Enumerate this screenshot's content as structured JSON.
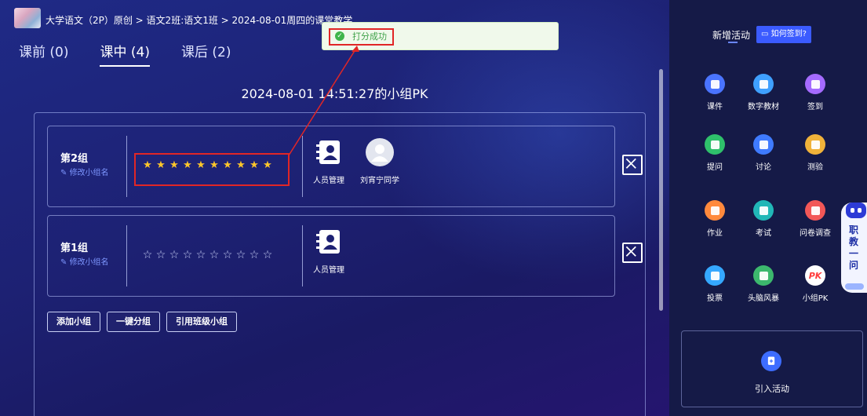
{
  "breadcrumb": {
    "course": "大学语文（2P）原创",
    "class": "语文2班:语文1班",
    "session": "2024-08-01周四的课堂教学",
    "sep": ">"
  },
  "tabs": [
    {
      "label": "课前 (0)",
      "active": false
    },
    {
      "label": "课中 (4)",
      "active": true
    },
    {
      "label": "课后 (2)",
      "active": false
    }
  ],
  "toast": {
    "message": "打分成功"
  },
  "pk_title": "2024-08-01 14:51:27的小组PK",
  "groups": [
    {
      "name": "第2组",
      "rename_label": "修改小组名",
      "stars": "★★★★★★★★★★",
      "rating": 10,
      "max_rating": 10,
      "members": [
        {
          "label": "人员管理",
          "icon": "contacts-icon"
        },
        {
          "label": "刘宵宁同学",
          "icon": "avatar-icon"
        }
      ]
    },
    {
      "name": "第1组",
      "rename_label": "修改小组名",
      "stars": "☆☆☆☆☆☆☆☆☆☆",
      "rating": 0,
      "max_rating": 10,
      "members": [
        {
          "label": "人员管理",
          "icon": "contacts-icon"
        }
      ]
    }
  ],
  "buttons": {
    "add_group": "添加小组",
    "auto_group": "一键分组",
    "import_class_group": "引用班级小组"
  },
  "sidebar": {
    "new_activity": "新增活动",
    "how_to_checkin": "如何签到?",
    "activities": [
      {
        "label": "课件",
        "icon": "courseware-icon",
        "color": "#4a74ff"
      },
      {
        "label": "数字教材",
        "icon": "digital-textbook-icon",
        "color": "#3fa0ff"
      },
      {
        "label": "签到",
        "icon": "checkin-icon",
        "color": "#a56bff"
      },
      {
        "label": "提问",
        "icon": "question-icon",
        "color": "#2fc06b"
      },
      {
        "label": "讨论",
        "icon": "discussion-icon",
        "color": "#3f7bff"
      },
      {
        "label": "测验",
        "icon": "quiz-icon",
        "color": "#f0b23a"
      },
      {
        "label": "作业",
        "icon": "homework-icon",
        "color": "#ff8a3d"
      },
      {
        "label": "考试",
        "icon": "exam-icon",
        "color": "#21b7b7"
      },
      {
        "label": "问卷调查",
        "icon": "survey-icon",
        "color": "#f25757"
      },
      {
        "label": "投票",
        "icon": "vote-icon",
        "color": "#35a8ff"
      },
      {
        "label": "头脑风暴",
        "icon": "brainstorm-icon",
        "color": "#3cb86d"
      },
      {
        "label": "小组PK",
        "icon": "pk-icon",
        "color": "#ffffff",
        "text": "PK",
        "text_color": "#ff3b3b"
      }
    ],
    "import_activity": "引入活动"
  },
  "helper": {
    "label": "职教一问"
  },
  "colors": {
    "accent": "#3b5bff",
    "star": "#ffc62b",
    "success": "#3fb54a",
    "highlight": "#e12626"
  }
}
